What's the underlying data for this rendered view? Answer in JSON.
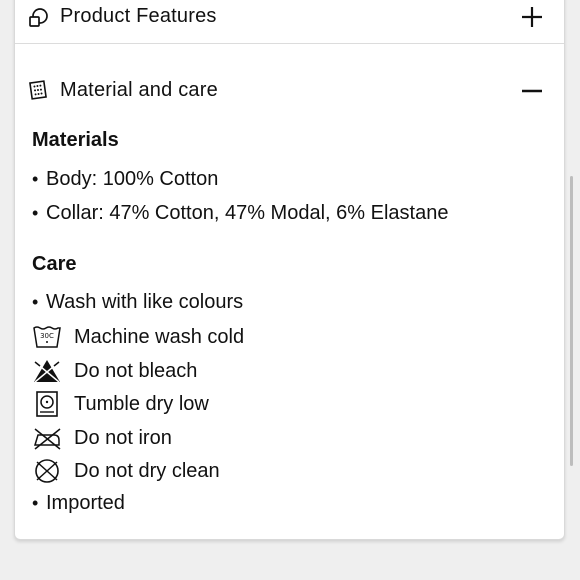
{
  "accordion": {
    "features": {
      "title": "Product Features",
      "icon": "shapes-icon",
      "toggle": "plus-icon"
    },
    "material": {
      "title": "Material and care",
      "icon": "fabric-tag-icon",
      "toggle": "minus-icon"
    }
  },
  "materials": {
    "heading": "Materials",
    "items": [
      "Body: 100% Cotton",
      "Collar: 47% Cotton, 47% Modal, 6% Elastane"
    ]
  },
  "care": {
    "heading": "Care",
    "bullet_first": "Wash with like colours",
    "instructions": [
      {
        "label": "Machine wash cold",
        "icon": "machine-wash-30-icon",
        "icon_text": "30C"
      },
      {
        "label": "Do not bleach",
        "icon": "no-bleach-icon"
      },
      {
        "label": "Tumble dry low",
        "icon": "tumble-dry-low-icon"
      },
      {
        "label": "Do not iron",
        "icon": "no-iron-icon"
      },
      {
        "label": "Do not dry clean",
        "icon": "no-dry-clean-icon"
      }
    ],
    "bullet_last": "Imported"
  },
  "colors": {
    "background": "#efefef",
    "card": "#ffffff",
    "text": "#111111",
    "divider": "#dcdcdc"
  }
}
